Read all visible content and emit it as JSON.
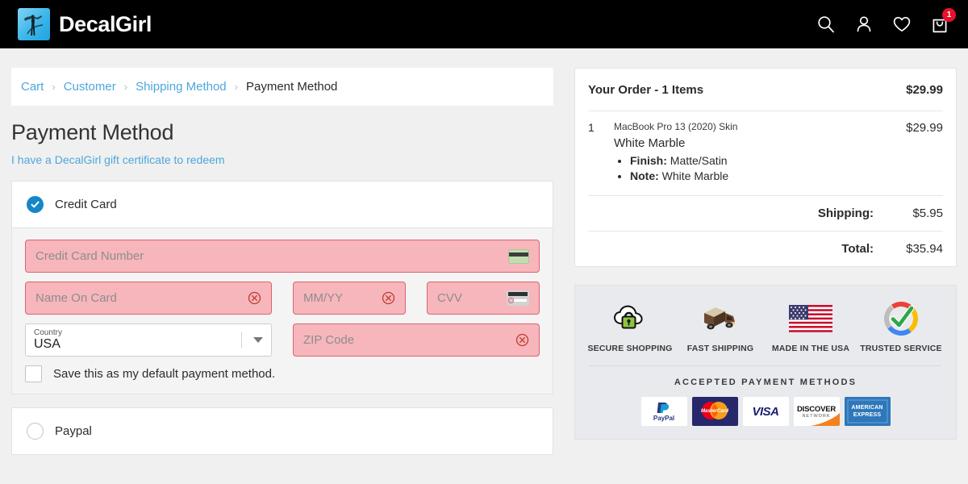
{
  "header": {
    "brand_name": "DecalGirl",
    "brand_mark": "decalgirl-logo-icon",
    "icons": [
      {
        "name": "search-icon",
        "label": "Search"
      },
      {
        "name": "account-icon",
        "label": "Account"
      },
      {
        "name": "wishlist-heart-icon",
        "label": "Wishlist"
      },
      {
        "name": "shopping-bag-icon",
        "label": "Cart"
      }
    ],
    "cart_badge": "1"
  },
  "breadcrumb": {
    "items": [
      {
        "label": "Cart",
        "current": false
      },
      {
        "label": "Customer",
        "current": false
      },
      {
        "label": "Shipping Method",
        "current": false
      },
      {
        "label": "Payment Method",
        "current": true
      }
    ],
    "separator": "›"
  },
  "page": {
    "title": "Payment Method",
    "gift_link": "I have a DecalGirl gift certificate to redeem"
  },
  "credit_card": {
    "label": "Credit Card",
    "selected": true,
    "fields": {
      "card_number": {
        "placeholder": "Credit Card Number",
        "value": "",
        "error": true,
        "icon": "credit-card-icon"
      },
      "name_on_card": {
        "placeholder": "Name On Card",
        "value": "",
        "error": true,
        "icon": "error-circle-icon"
      },
      "expiry": {
        "placeholder": "MM/YY",
        "value": "",
        "error": true,
        "icon": "error-circle-icon"
      },
      "cvv": {
        "placeholder": "CVV",
        "value": "",
        "error": true,
        "icon": "card-back-cvv-icon"
      },
      "country": {
        "label": "Country",
        "value": "USA",
        "error": false,
        "icon": "chevron-down-icon"
      },
      "zip": {
        "placeholder": "ZIP Code",
        "value": "",
        "error": true,
        "icon": "error-circle-icon"
      }
    },
    "save_default": {
      "label": "Save this as my default payment method.",
      "checked": false
    }
  },
  "paypal": {
    "label": "Paypal",
    "selected": false
  },
  "order": {
    "heading": "Your Order - 1 Items",
    "heading_amount": "$29.99",
    "items": [
      {
        "qty": "1",
        "sku": "MacBook Pro 13 (2020) Skin",
        "design": "White Marble",
        "options": [
          {
            "label": "Finish:",
            "value": "Matte/Satin"
          },
          {
            "label": "Note:",
            "value": "White Marble"
          }
        ],
        "price": "$29.99"
      }
    ],
    "totals": [
      {
        "label": "Shipping:",
        "value": "$5.95"
      },
      {
        "label": "Total:",
        "value": "$35.94"
      }
    ]
  },
  "trust": {
    "badges": [
      {
        "icon": "cloud-lock-icon",
        "caption": "SECURE SHOPPING"
      },
      {
        "icon": "delivery-truck-icon",
        "caption": "FAST SHIPPING"
      },
      {
        "icon": "usa-flag-icon",
        "caption": "MADE IN THE USA"
      },
      {
        "icon": "check-circle-icon",
        "caption": "TRUSTED SERVICE"
      }
    ],
    "payments_title": "ACCEPTED PAYMENT METHODS",
    "payments": [
      {
        "name": "paypal-logo",
        "label": "PayPal"
      },
      {
        "name": "mastercard-logo",
        "label": "MasterCard"
      },
      {
        "name": "visa-logo",
        "label": "VISA"
      },
      {
        "name": "discover-logo",
        "label": "DISCOVER",
        "sub": "NETWORK"
      },
      {
        "name": "amex-logo",
        "label": "AMERICAN",
        "sub": "EXPRESS"
      }
    ]
  },
  "colors": {
    "accent_blue": "#4da6dd",
    "radio_blue": "#1686c8",
    "error_pink": "#f7b6bc",
    "error_border": "#d9646f",
    "badge_red": "#e8112d",
    "header_black": "#000000"
  }
}
